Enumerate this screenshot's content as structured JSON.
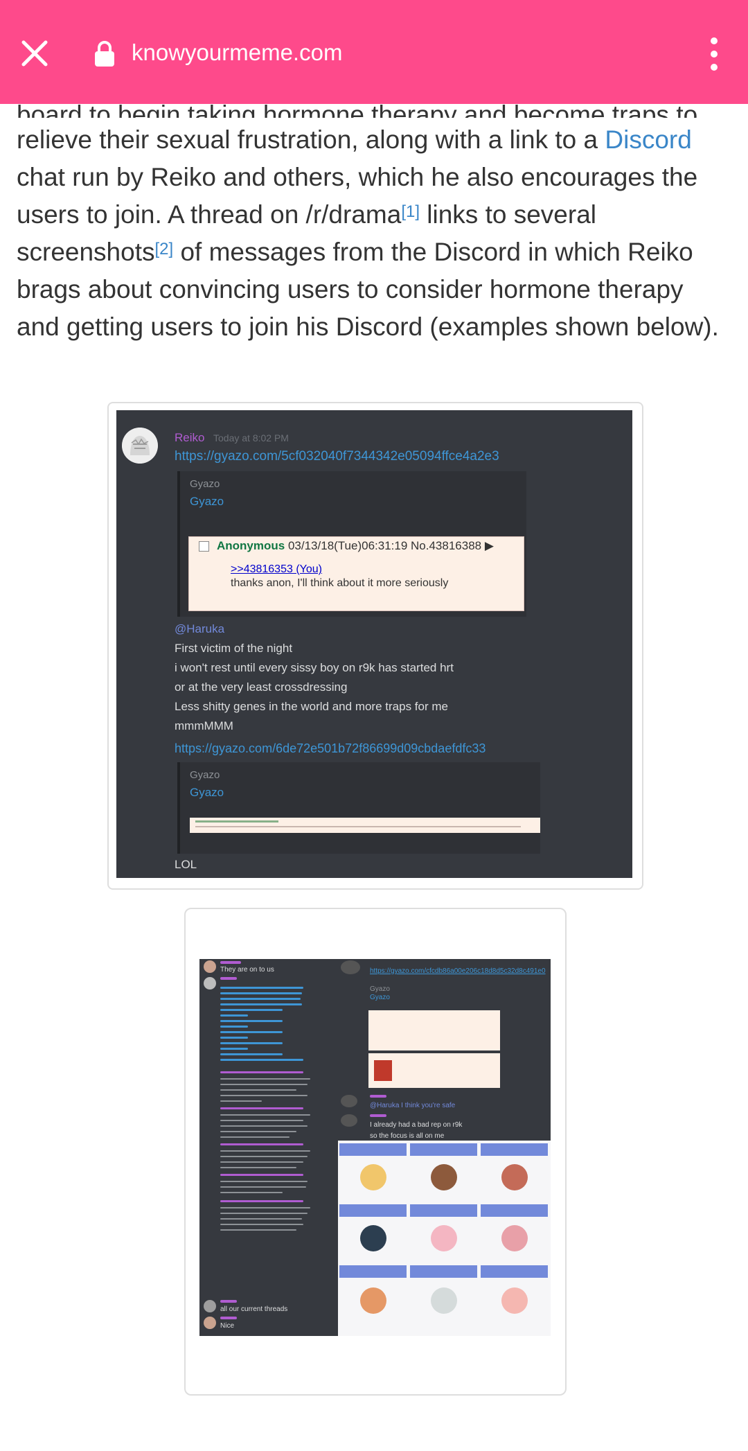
{
  "browser": {
    "url": "knowyourmeme.com",
    "close_icon": "close-icon",
    "lock_icon": "lock-icon",
    "menu_icon": "more-vert-icon",
    "bar_color": "#fe4a8b"
  },
  "article": {
    "cut_line": "board to begin taking hormone therapy and become traps to",
    "p1": "relieve their sexual frustration, along with a link to a ",
    "link_discord": "Discord",
    "p2": " chat run by Reiko and others, which he also encourages the users to join. A thread on /r/drama",
    "ref1": "[1]",
    "p3": " links to several screenshots",
    "ref2": "[2]",
    "p4": " of messages from the Discord in which Reiko brags about convincing users to consider hormone therapy and getting users to join his Discord (examples shown below).",
    "link_color": "#3a86c8"
  },
  "screenshot1": {
    "username": "Reiko",
    "timestamp": "Today at 8:02 PM",
    "link1": "https://gyazo.com/5cf032040f7344342e05094ffce4a2e3",
    "embed1_provider": "Gyazo",
    "embed1_title": "Gyazo",
    "post_header": "Anonymous",
    "post_datetime": "03/13/18(Tue)06:31:19 No.43816388 ▶",
    "post_ref": ">>43816353 (You)",
    "post_text": "thanks anon, I'll think about it more seriously",
    "mention": "@Haruka",
    "lines": [
      "First victim of the night",
      "i won't rest until every sissy boy on r9k has started hrt",
      "or at the very least crossdressing",
      "Less shitty genes in the world and more traps for me",
      "mmmMMM"
    ],
    "link2": "https://gyazo.com/6de72e501b72f86699d09cbdaefdfc33",
    "embed2_provider": "Gyazo",
    "embed2_title": "Gyazo",
    "last_line": "LOL"
  },
  "screenshot2": {
    "left_top": "They are on to us",
    "bottom_lines": [
      "all our current threads",
      "Nice"
    ],
    "right_link": "https://gyazo.com/cfcdb86a00e206c18d8d5c32d8c491e0",
    "right_provider": "Gyazo",
    "right_title": "Gyazo",
    "right_msg1": "@Haruka I think you're safe",
    "right_msg2": "I already had a bad rep on r9k",
    "right_msg3": "so the focus is all on me"
  }
}
